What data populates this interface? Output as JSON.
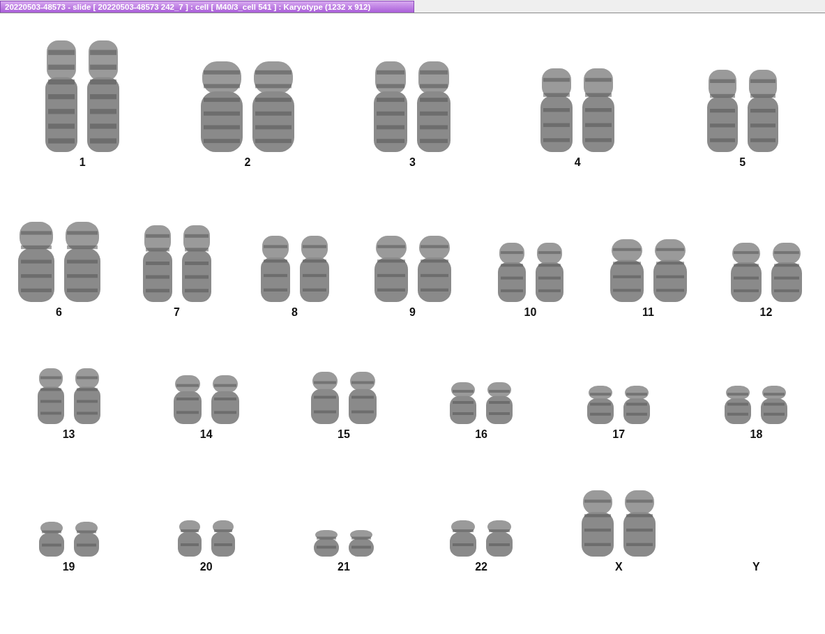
{
  "window": {
    "title": "20220503-48573 - slide [ 20220503-48573 242_7 ] : cell [ M40/3_cell 541 ] : Karyotype  (1232 x 912)"
  },
  "karyotype": {
    "rows": [
      {
        "chromosomes": [
          {
            "label": "1",
            "kind": "pair"
          },
          {
            "label": "2",
            "kind": "pair"
          },
          {
            "label": "3",
            "kind": "pair"
          },
          {
            "label": "4",
            "kind": "pair"
          },
          {
            "label": "5",
            "kind": "pair"
          }
        ]
      },
      {
        "chromosomes": [
          {
            "label": "6",
            "kind": "pair"
          },
          {
            "label": "7",
            "kind": "pair"
          },
          {
            "label": "8",
            "kind": "pair"
          },
          {
            "label": "9",
            "kind": "pair"
          },
          {
            "label": "10",
            "kind": "pair"
          },
          {
            "label": "11",
            "kind": "pair"
          },
          {
            "label": "12",
            "kind": "pair"
          }
        ]
      },
      {
        "chromosomes": [
          {
            "label": "13",
            "kind": "pair"
          },
          {
            "label": "14",
            "kind": "pair"
          },
          {
            "label": "15",
            "kind": "pair"
          },
          {
            "label": "16",
            "kind": "pair"
          },
          {
            "label": "17",
            "kind": "pair"
          },
          {
            "label": "18",
            "kind": "pair"
          }
        ]
      },
      {
        "chromosomes": [
          {
            "label": "19",
            "kind": "pair"
          },
          {
            "label": "20",
            "kind": "pair"
          },
          {
            "label": "21",
            "kind": "pair"
          },
          {
            "label": "22",
            "kind": "pair"
          },
          {
            "label": "X",
            "kind": "pair"
          },
          {
            "label": "Y",
            "kind": "empty"
          }
        ]
      }
    ]
  }
}
